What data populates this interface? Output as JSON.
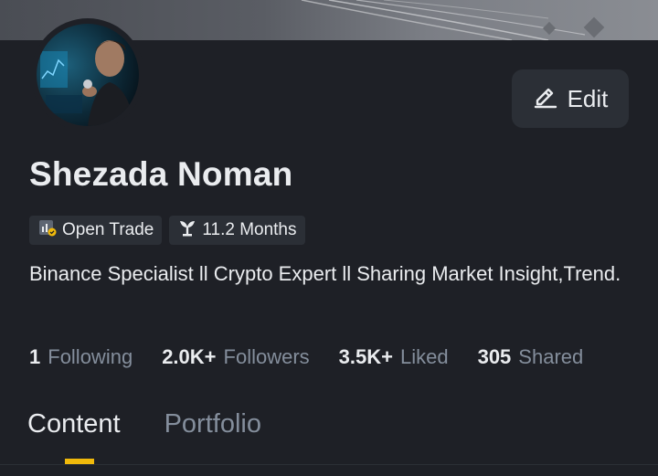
{
  "profile": {
    "name": "Shezada Noman",
    "edit_label": "Edit",
    "badges": [
      {
        "label": "Open Trade",
        "icon": "open-trade-icon"
      },
      {
        "label": "11.2 Months",
        "icon": "sprout-icon"
      }
    ],
    "bio": "Binance Specialist ll Crypto Expert ll Sharing Market Insight,Trend."
  },
  "stats": [
    {
      "value": "1",
      "label": "Following"
    },
    {
      "value": "2.0K+",
      "label": "Followers"
    },
    {
      "value": "3.5K+",
      "label": "Liked"
    },
    {
      "value": "305",
      "label": "Shared"
    }
  ],
  "tabs": [
    {
      "label": "Content",
      "active": true
    },
    {
      "label": "Portfolio",
      "active": false
    }
  ],
  "colors": {
    "background": "#1e2026",
    "card": "#2b2f36",
    "text": "#eaecef",
    "muted": "#848e9c",
    "accent": "#f0b90b"
  }
}
